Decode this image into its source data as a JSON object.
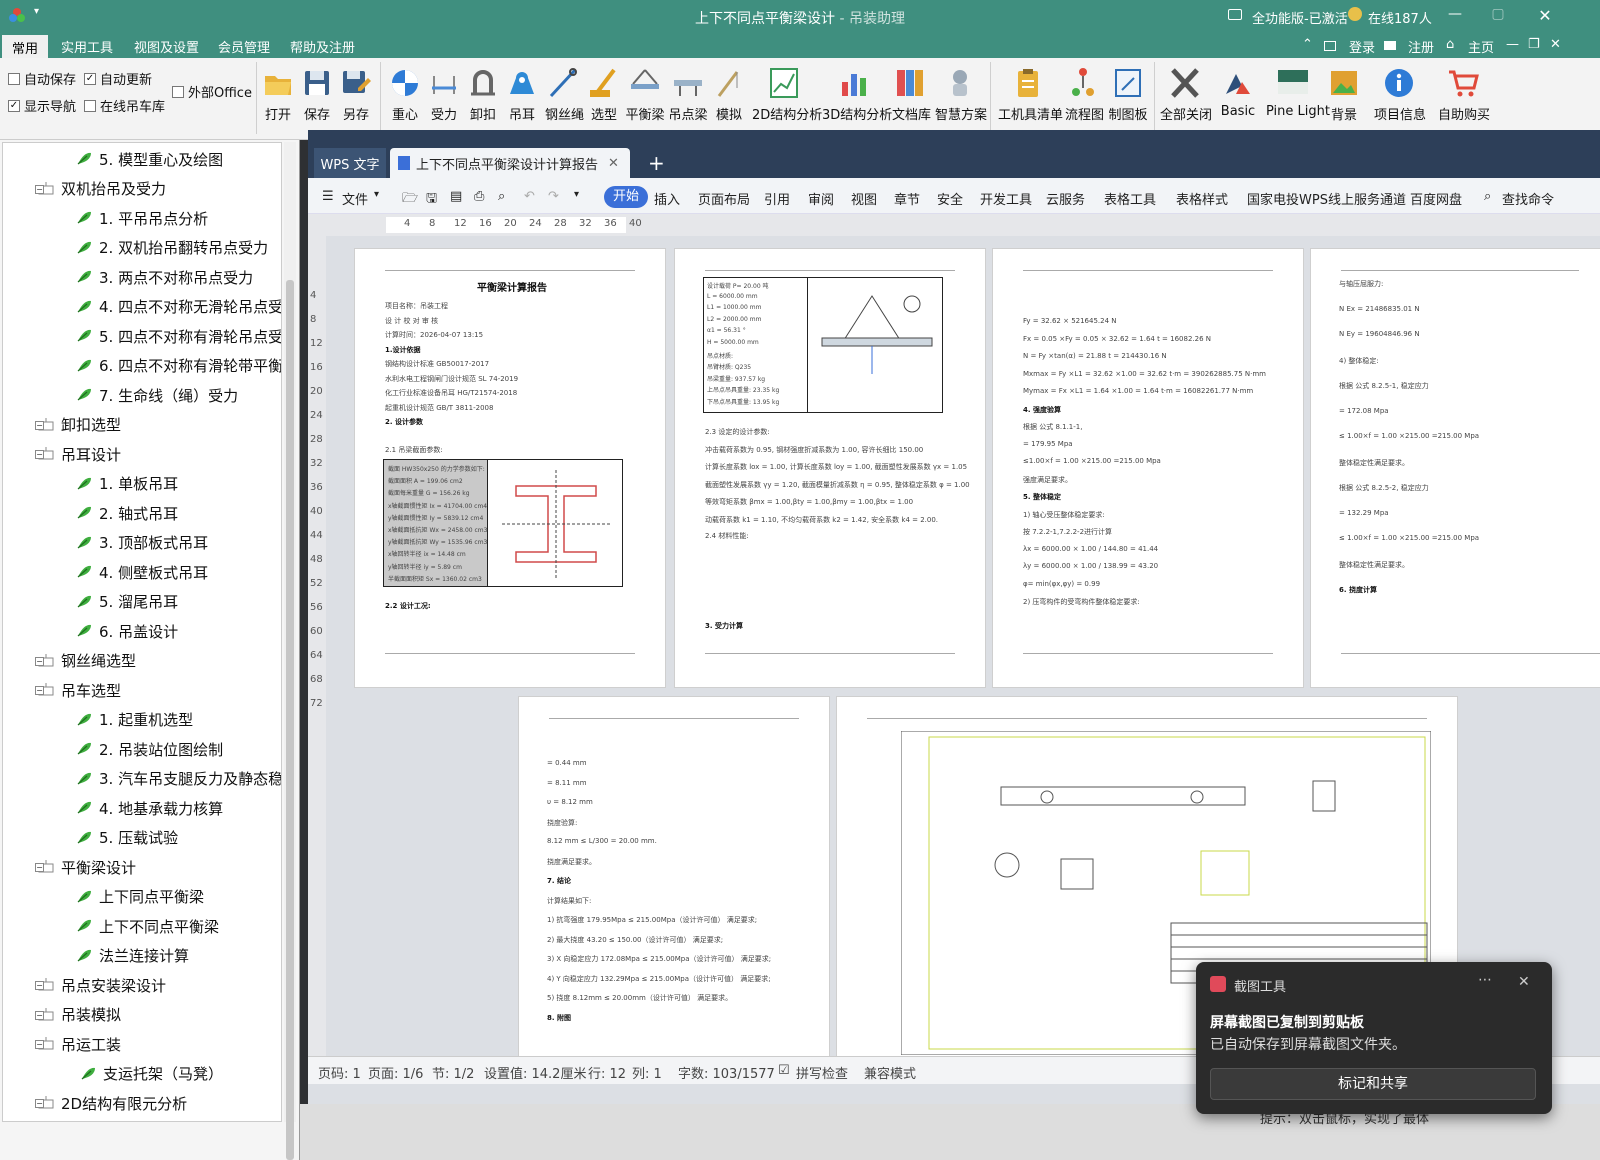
{
  "titlebar": {
    "title": "上下不同点平衡梁设计",
    "subtitle": "- 吊装助理",
    "edition": "全功能版-已激活",
    "online": "在线187人"
  },
  "menu": {
    "items": [
      "常用",
      "实用工具",
      "视图及设置",
      "会员管理",
      "帮助及注册"
    ],
    "right": [
      "登录",
      "注册",
      "主页"
    ]
  },
  "ribbon": {
    "checks": [
      {
        "label": "自动保存",
        "checked": false
      },
      {
        "label": "自动更新",
        "checked": true
      },
      {
        "label": "外部Office",
        "checked": false
      },
      {
        "label": "显示导航",
        "checked": true
      },
      {
        "label": "在线吊车库",
        "checked": false
      }
    ],
    "buttons": [
      "打开",
      "保存",
      "另存",
      "重心",
      "受力",
      "卸扣",
      "吊耳",
      "钢丝绳",
      "选型",
      "平衡梁",
      "吊点梁",
      "模拟",
      "2D结构分析",
      "3D结构分析",
      "文档库",
      "智慧方案",
      "工机具清单",
      "流程图",
      "制图板",
      "全部关闭",
      "Basic",
      "Pine Light",
      "背景",
      "项目信息",
      "自助购买"
    ],
    "icons": [
      "folder-open-icon",
      "save-icon",
      "save-as-icon",
      "center-of-gravity-icon",
      "force-icon",
      "shackle-icon",
      "lifting-lug-icon",
      "wire-rope-icon",
      "crane-selection-icon",
      "balance-beam-icon",
      "lifting-beam-icon",
      "simulation-icon",
      "chart-2d-icon",
      "chart-3d-icon",
      "document-library-icon",
      "robot-icon",
      "clipboard-icon",
      "flowchart-icon",
      "drawing-board-icon",
      "close-all-icon",
      "theme-basic-icon",
      "theme-pine-light-icon",
      "background-icon",
      "info-icon",
      "cart-icon"
    ]
  },
  "tree": {
    "nodes": [
      {
        "label": "5. 模型重心及绘图",
        "level": 2
      },
      {
        "label": "双机抬吊及受力",
        "level": 1
      },
      {
        "label": "1. 平吊吊点分析",
        "level": 2
      },
      {
        "label": "2. 双机抬吊翻转吊点受力",
        "level": 2
      },
      {
        "label": "3. 两点不对称吊点受力",
        "level": 2
      },
      {
        "label": "4. 四点不对称无滑轮吊点受",
        "level": 2
      },
      {
        "label": "5. 四点不对称有滑轮吊点受",
        "level": 2
      },
      {
        "label": "6. 四点不对称有滑轮带平衡",
        "level": 2
      },
      {
        "label": "7. 生命线（绳）受力",
        "level": 2
      },
      {
        "label": "卸扣选型",
        "level": 1
      },
      {
        "label": "吊耳设计",
        "level": 1
      },
      {
        "label": "1. 单板吊耳",
        "level": 2
      },
      {
        "label": "2. 轴式吊耳",
        "level": 2
      },
      {
        "label": "3. 顶部板式吊耳",
        "level": 2
      },
      {
        "label": "4. 侧壁板式吊耳",
        "level": 2
      },
      {
        "label": "5. 溜尾吊耳",
        "level": 2
      },
      {
        "label": "6. 吊盖设计",
        "level": 2
      },
      {
        "label": "钢丝绳选型",
        "level": 1
      },
      {
        "label": "吊车选型",
        "level": 1
      },
      {
        "label": "1. 起重机选型",
        "level": 2
      },
      {
        "label": "2. 吊装站位图绘制",
        "level": 2
      },
      {
        "label": "3. 汽车吊支腿反力及静态稳",
        "level": 2
      },
      {
        "label": "4. 地基承载力核算",
        "level": 2
      },
      {
        "label": "5. 压载试验",
        "level": 2
      },
      {
        "label": "平衡梁设计",
        "level": 1
      },
      {
        "label": "上下同点平衡梁",
        "level": 2
      },
      {
        "label": "上下不同点平衡梁",
        "level": 2
      },
      {
        "label": "法兰连接计算",
        "level": 2
      },
      {
        "label": "吊点安装梁设计",
        "level": 1
      },
      {
        "label": "吊装模拟",
        "level": 1
      },
      {
        "label": "吊运工装",
        "level": 1
      },
      {
        "label": "支运托架（马凳）",
        "level": 3
      },
      {
        "label": "2D结构有限元分析",
        "level": 1
      }
    ]
  },
  "wps": {
    "tabs": [
      "WPS 文字",
      "上下不同点平衡梁设计计算报告"
    ],
    "file_menu": "文件",
    "start": "开始",
    "menus": [
      "插入",
      "页面布局",
      "引用",
      "审阅",
      "视图",
      "章节",
      "安全",
      "开发工具",
      "云服务",
      "表格工具",
      "表格样式",
      "国家电投WPS线上服务通道",
      "百度网盘",
      "查找命令"
    ],
    "ruler_h": [
      "4",
      "8",
      "12",
      "16",
      "20",
      "24",
      "28",
      "32",
      "36",
      "40"
    ],
    "ruler_v": [
      "4",
      "8",
      "12",
      "16",
      "20",
      "24",
      "28",
      "32",
      "36",
      "40",
      "44",
      "48",
      "52",
      "56",
      "60",
      "64",
      "68",
      "72"
    ],
    "page1": {
      "title": "平衡梁计算报告",
      "lines": [
        "项目名称：吊装工程",
        "设   计          校   对           审   核",
        "计算时间：2026-04-07  13:15",
        "1.设计依据",
        "钢结构设计标准            GB50017-2017",
        "水利水电工程钢闸门设计规范  SL 74-2019",
        "化工行业标准设备吊耳    HG/T21574-2018",
        "起重机设计规范            GB/T 3811-2008",
        "2. 设计参数",
        "2.1  吊梁截面参数:",
        "2.2  设计工况:"
      ],
      "table": [
        "截面 HW350x250 的力学参数如下:",
        "截面面积 A = 199.06 cm2",
        "截面每米重量 G = 156.26 kg",
        "x轴截面惯性矩 Ix = 41704.00 cm4",
        "y轴截面惯性矩 Iy = 5839.12 cm4",
        "x轴截面抵抗矩 Wx = 2458.00 cm3",
        "y轴截面抵抗矩 Wy = 1535.96 cm3",
        "x轴回转半径 ix = 14.48 cm",
        "y轴回转半径 iy = 5.89 cm",
        "半截面面积矩 Sx = 1360.02 cm3"
      ]
    },
    "page2": {
      "lines": [
        "设计载荷 P= 20.00 吨",
        "L = 6000.00 mm",
        "L1 = 1000.00 mm",
        "L2 = 2000.00 mm",
        "α1 = 56.31 °",
        "H = 5000.00 mm",
        "吊点材质:",
        "吊臂材质: Q235",
        "吊梁重量: 937.57 kg",
        "上吊点吊具重量: 23.35 kg",
        "下吊点吊具重量: 13.95 kg",
        "2.3  设定的设计参数:",
        "冲击载荷系数为 0.95, 钢材强度折减系数为 1.00, 容许长细比 150.00",
        "计算长度系数 lox = 1.00, 计算长度系数 loy = 1.00, 截面塑性发展系数 γx = 1.05",
        "截面塑性发展系数 γy = 1.20, 截面模量折减系数 η = 0.95, 整体稳定系数 φ = 1.00",
        "等效弯矩系数 βmx = 1.00,βty = 1.00,βmy = 1.00,βtx = 1.00",
        "动载荷系数 k1 = 1.10, 不均匀载荷系数 k2 = 1.42, 安全系数 k4 = 2.00.",
        "2.4  材料性能:",
        "3.  受力计算"
      ]
    },
    "page3": {
      "lines": [
        "Fy = 32.62 × 521645.24 N",
        "Fx = 0.05 ×Fy = 0.05 × 32.62 = 1.64 t = 16082.26 N",
        "N = Fy ×tan(α) = 21.88 t = 214430.16 N",
        "Mxmax = Fy ×L1 = 32.62 ×1.00 = 32.62 t·m = 390262885.75 N·mm",
        "Mymax = Fx ×L1 = 1.64 ×1.00 = 1.64 t·m = 16082261.77 N·mm",
        "4. 强度验算",
        "根据 公式 8.1.1-1,",
        "= 179.95 Mpa",
        "≤1.00×f = 1.00 ×215.00 =215.00 Mpa",
        "强度满足要求。",
        "5. 整体稳定",
        "1) 轴心受压整体稳定要求:",
        "按 7.2.2-1,7.2.2-2进行计算",
        "λx = 6000.00 × 1.00 / 144.80 = 41.44",
        "λy = 6000.00 × 1.00 / 138.99 = 43.20",
        "φ= min(φx,φy) = 0.99",
        "2) 压弯构件的受弯构件整体稳定要求:"
      ]
    },
    "page4": {
      "lines": [
        "与轴压屈服力:",
        "N Ex = 21486835.01 N",
        "N Ey = 19604846.96 N",
        "4) 整体稳定:",
        "根据 公式 8.2.5-1, 稳定应力",
        "= 172.08 Mpa",
        "≤ 1.00×f = 1.00 ×215.00 =215.00 Mpa",
        "整体稳定性满足要求。",
        "根据 公式 8.2.5-2, 稳定应力",
        "= 132.29 Mpa",
        "≤ 1.00×f = 1.00 ×215.00 =215.00 Mpa",
        "整体稳定性满足要求。",
        "6. 挠度计算"
      ]
    },
    "page5": {
      "lines": [
        "= 0.44 mm",
        "= 8.11 mm",
        "υ = 8.12 mm",
        "挠度验算:",
        "8.12 mm ≤ L/300 = 20.00 mm.",
        "挠度满足要求。",
        "7. 结论",
        "计算结果如下:",
        "1) 抗弯强度 179.95Mpa ≤ 215.00Mpa（设计许可值） 满足要求;",
        "2) 最大挠度 43.20 ≤ 150.00（设计许可值） 满足要求;",
        "3) X 向稳定应力 172.08Mpa ≤ 215.00Mpa（设计许可值） 满足要求;",
        "4) Y 向稳定应力 132.29Mpa ≤ 215.00Mpa（设计许可值） 满足要求;",
        "5) 挠度 8.12mm ≤ 20.00mm（设计许可值） 满足要求。",
        "8. 附图"
      ]
    },
    "status": [
      "页码: 1",
      "页面: 1/6",
      "节: 1/2",
      "设置值: 14.2厘米",
      "行: 12",
      "列: 1",
      "字数: 103/1577",
      "拼写检查",
      "兼容模式"
    ]
  },
  "toast": {
    "app": "截图工具",
    "title": "屏幕截图已复制到剪贴板",
    "body": "已自动保存到屏幕截图文件夹。",
    "button": "标记和共享"
  },
  "bottom_hint": "提示：双击鼠标，实现了最体"
}
